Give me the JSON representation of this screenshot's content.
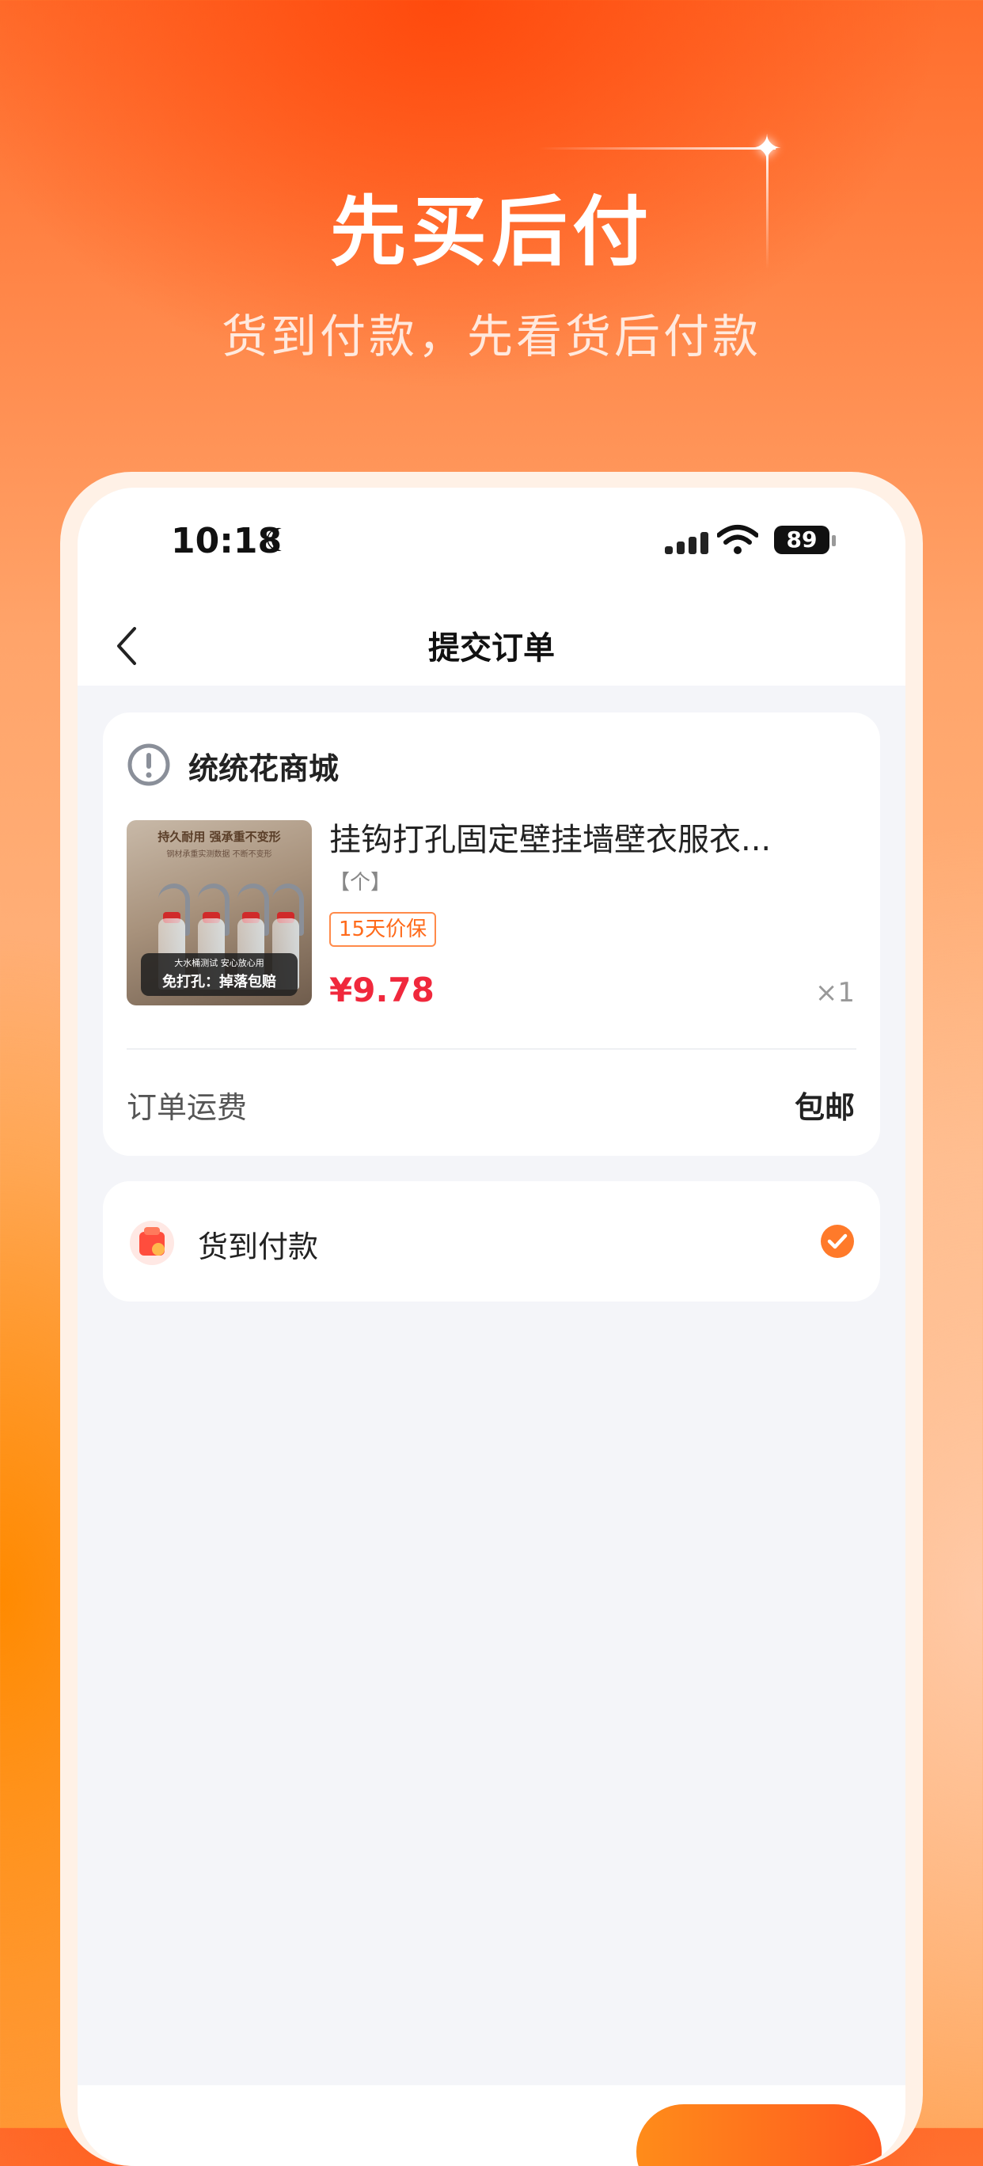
{
  "hero": {
    "title": "先买后付",
    "subtitle": "货到付款，先看货后付款"
  },
  "status_bar": {
    "time": "10:18",
    "battery": "89"
  },
  "nav": {
    "title": "提交订单"
  },
  "shop": {
    "name": "统统花商城",
    "product": {
      "title": "挂钩打孔固定壁挂墙壁衣服衣...",
      "spec": "【个】",
      "tag": "15天价保",
      "price": "¥9.78",
      "quantity": "×1",
      "image_text": {
        "top": "持久耐用 强承重不变形",
        "top_small": "钢材承重实测数据 不断不变形",
        "badge_small": "大水桶测试 安心放心用",
        "badge_big": "免打孔：掉落包赔"
      }
    },
    "shipping_label": "订单运费",
    "shipping_value": "包邮"
  },
  "payment": {
    "method_label": "货到付款",
    "selected": true
  },
  "colors": {
    "accent": "#ff7a2a",
    "price": "#f0283c"
  }
}
